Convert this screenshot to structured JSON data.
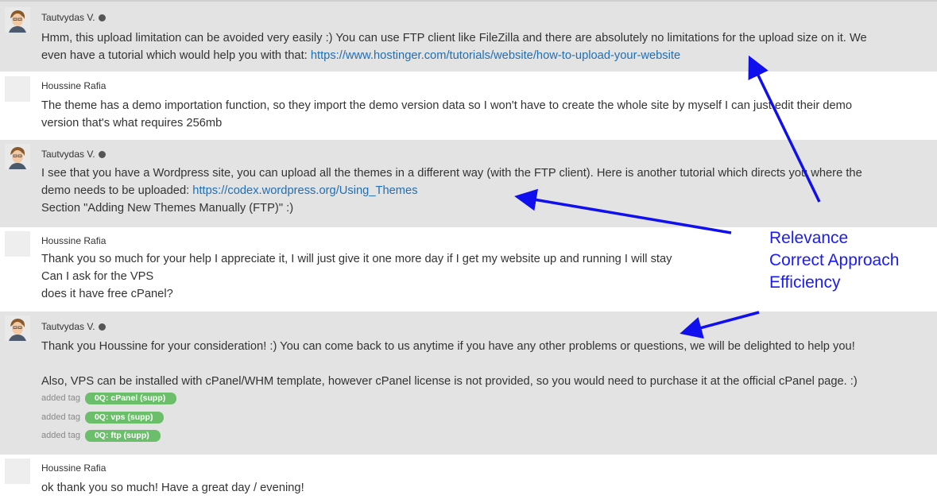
{
  "messages": [
    {
      "author": "Tautvydas V.",
      "role": "agent",
      "line1": "Hmm, this upload limitation can be avoided very easily :) You can use FTP client like FileZilla and there are absolutely no limitations for the upload size on it. We",
      "line2_text": "even have a tutorial which would help you with that: ",
      "line2_link": "https://www.hostinger.com/tutorials/website/how-to-upload-your-website"
    },
    {
      "author": "Houssine Rafia",
      "role": "customer",
      "line1": "The theme has a demo importation function, so they import the demo version data so I won't have to create the whole site by myself I can just edit their demo",
      "line2": "version that's what requires 256mb"
    },
    {
      "author": "Tautvydas V.",
      "role": "agent",
      "line1": "I see that you have a Wordpress site, you can upload all the themes in a different way (with the FTP client). Here is another tutorial which directs you where the",
      "line2_text": "demo needs to be uploaded: ",
      "line2_link": "https://codex.wordpress.org/Using_Themes",
      "line3": "Section \"Adding New Themes Manually (FTP)\" :)"
    },
    {
      "author": "Houssine Rafia",
      "role": "customer",
      "line1": "Thank you so much for your help I appreciate it, I will just give it one more day if I get my website up and running I will stay",
      "line2": "Can I ask for the VPS",
      "line3": "does it have free cPanel?"
    },
    {
      "author": "Tautvydas V.",
      "role": "agent",
      "line1": "Thank you Houssine for your consideration! :) You can come back to us anytime if you have any other problems or questions, we will be delighted to help you!",
      "line2": "Also, VPS can be installed with cPanel/WHM template, however cPanel license is not provided, so you would need to purchase it at the official cPanel page. :)",
      "tags": [
        {
          "prefix": "added tag",
          "label": "0Q: cPanel (supp)"
        },
        {
          "prefix": "added tag",
          "label": "0Q: vps (supp)"
        },
        {
          "prefix": "added tag",
          "label": "0Q: ftp (supp)"
        }
      ]
    },
    {
      "author": "Houssine Rafia",
      "role": "customer",
      "line1": "ok thank you so much! Have a great day / evening!"
    }
  ],
  "annotation": {
    "labels": [
      "Relevance",
      "Correct Approach",
      "Efficiency"
    ],
    "color": "#1a1aff"
  },
  "colors": {
    "agent_bg": "#e3e3e3",
    "link": "#1f6fb5",
    "tag_bg": "#6bbf6b"
  }
}
